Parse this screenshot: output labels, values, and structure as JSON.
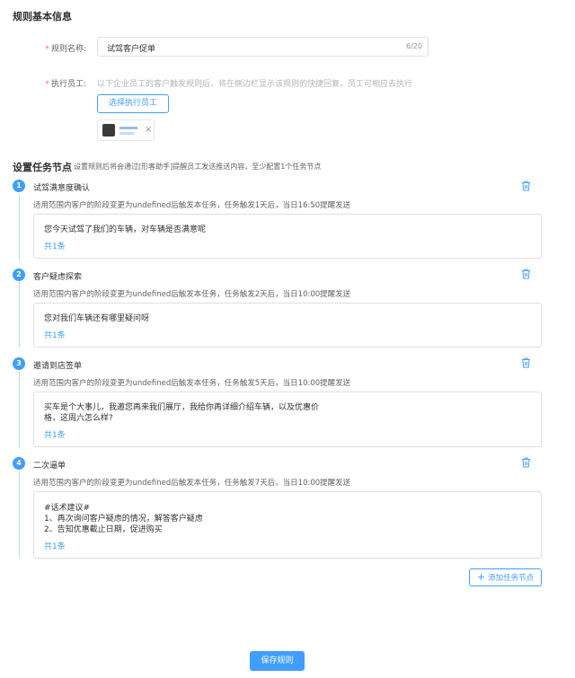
{
  "basic_info": {
    "title": "规则基本信息",
    "name_label": "规则名称:",
    "name_value": "试驾客户促单",
    "name_count": "6/20",
    "staff_label": "执行员工:",
    "staff_hint": "以下企业员工的客户触发规则后，将在侧边栏显示该规则的快捷回复，员工可相应去执行",
    "select_staff_button": "选择执行员工",
    "selected_staff_close": "×"
  },
  "task_section": {
    "title": "设置任务节点",
    "subtitle": "设置规则后将会通过[形客助手]提醒员工发送推送内容，至少配置1个任务节点",
    "add_button": "添加任务节点",
    "add_icon": "+"
  },
  "tasks": [
    {
      "index": "1",
      "title": "试驾满意度确认",
      "desc": "适用范围内客户的阶段变更为undefined后触发本任务，任务触发1天后，当日16:50提醒发送",
      "message": "您今天试驾了我们的车辆，对车辆是否满意呢",
      "count": "共1条"
    },
    {
      "index": "2",
      "title": "客户疑虑探索",
      "desc": "适用范围内客户的阶段变更为undefined后触发本任务，任务触发2天后，当日10:00提醒发送",
      "message": "您对我们车辆还有哪里疑问呀",
      "count": "共1条"
    },
    {
      "index": "3",
      "title": "邀请到店签单",
      "desc": "适用范围内客户的阶段变更为undefined后触发本任务，任务触发5天后，当日10:00提醒发送",
      "message": "买车是个大事儿，我邀您再来我们展厅，我给你再详细介绍车辆，以及优惠价\n格，这周六怎么样?",
      "count": "共1条"
    },
    {
      "index": "4",
      "title": "二次逼单",
      "desc": "适用范围内客户的阶段变更为undefined后触发本任务，任务触发7天后，当日10:00提醒发送",
      "message": "#话术建议#\n1、再次询问客户疑虑的情况，解答客户疑虑\n2、告知优惠截止日期，促进购买",
      "count": "共1条"
    }
  ],
  "footer": {
    "save_button": "保存规则"
  },
  "icons": {
    "trash": "trash-icon",
    "close": "close-icon",
    "plus": "plus-icon"
  },
  "colors": {
    "primary": "#409eff",
    "required": "#f56c6c"
  }
}
